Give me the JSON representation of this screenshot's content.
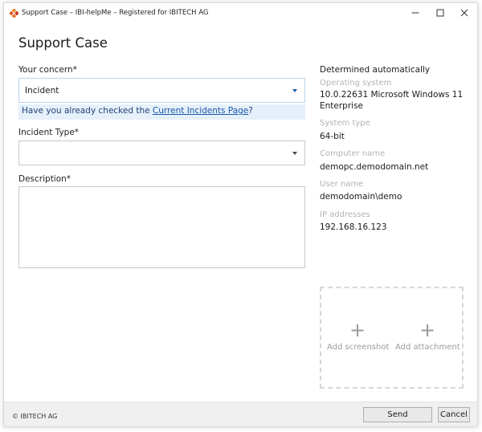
{
  "window": {
    "title": "Support Case – IBI-helpMe – Registered for IBITECH AG",
    "icon": "ibi-helpme-logo-icon"
  },
  "page": {
    "heading": "Support Case"
  },
  "form": {
    "concern_label": "Your concern*",
    "concern_value": "Incident",
    "hint_prefix": "Have you already checked the ",
    "hint_link": "Current Incidents Page",
    "hint_suffix": "?",
    "incident_type_label": "Incident Type*",
    "incident_type_value": "",
    "description_label": "Description*",
    "description_value": ""
  },
  "system_info": {
    "heading": "Determined automatically",
    "os_label": "Operating system",
    "os_value_line1": "10.0.22631 Microsoft Windows 11",
    "os_value_line2": "Enterprise",
    "type_label": "System type",
    "type_value": "64-bit",
    "computer_label": "Computer name",
    "computer_value": "demopc.demodomain.net",
    "user_label": "User name",
    "user_value": "demodomain\\demo",
    "ip_label": "IP addresses",
    "ip_value": "192.168.16.123"
  },
  "attachments": {
    "screenshot_label": "Add screenshot",
    "attachment_label": "Add attachment"
  },
  "footer": {
    "copyright": "© IBITECH AG",
    "send_label": "Send",
    "cancel_label": "Cancel"
  },
  "colors": {
    "accent": "#1d5fb0",
    "hint_background": "#e5f0fa",
    "footer_background": "#f0f0f0",
    "muted_label": "#b3b3b3"
  }
}
